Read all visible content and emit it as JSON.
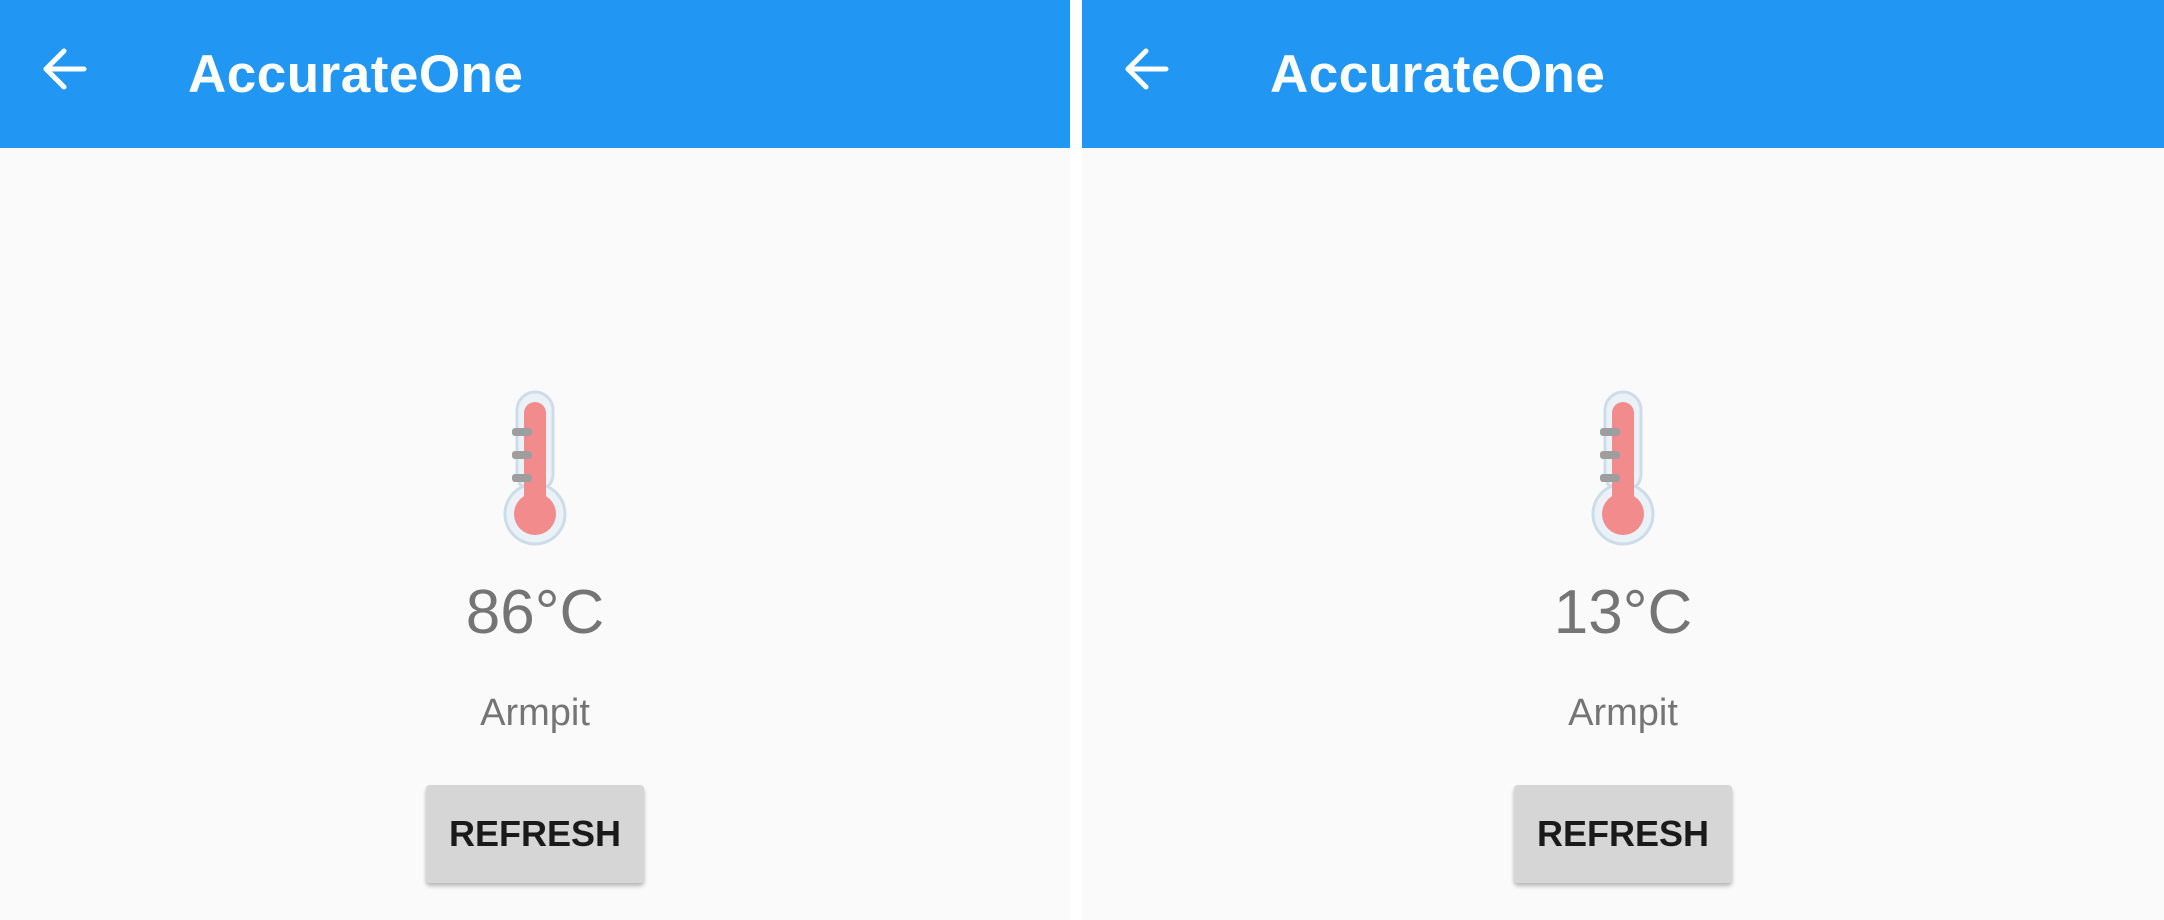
{
  "screens": [
    {
      "app_title": "AccurateOne",
      "temperature": "86°C",
      "site": "Armpit",
      "refresh_label": "REFRESH"
    },
    {
      "app_title": "AccurateOne",
      "temperature": "13°C",
      "site": "Armpit",
      "refresh_label": "REFRESH"
    }
  ],
  "colors": {
    "appbar": "#2196f3",
    "background": "#fafafa",
    "text_secondary": "#757575",
    "button": "#d6d6d6",
    "thermometer_fill": "#f28b8b"
  },
  "icons": {
    "back": "arrow-left-icon",
    "thermometer": "thermometer-icon"
  }
}
